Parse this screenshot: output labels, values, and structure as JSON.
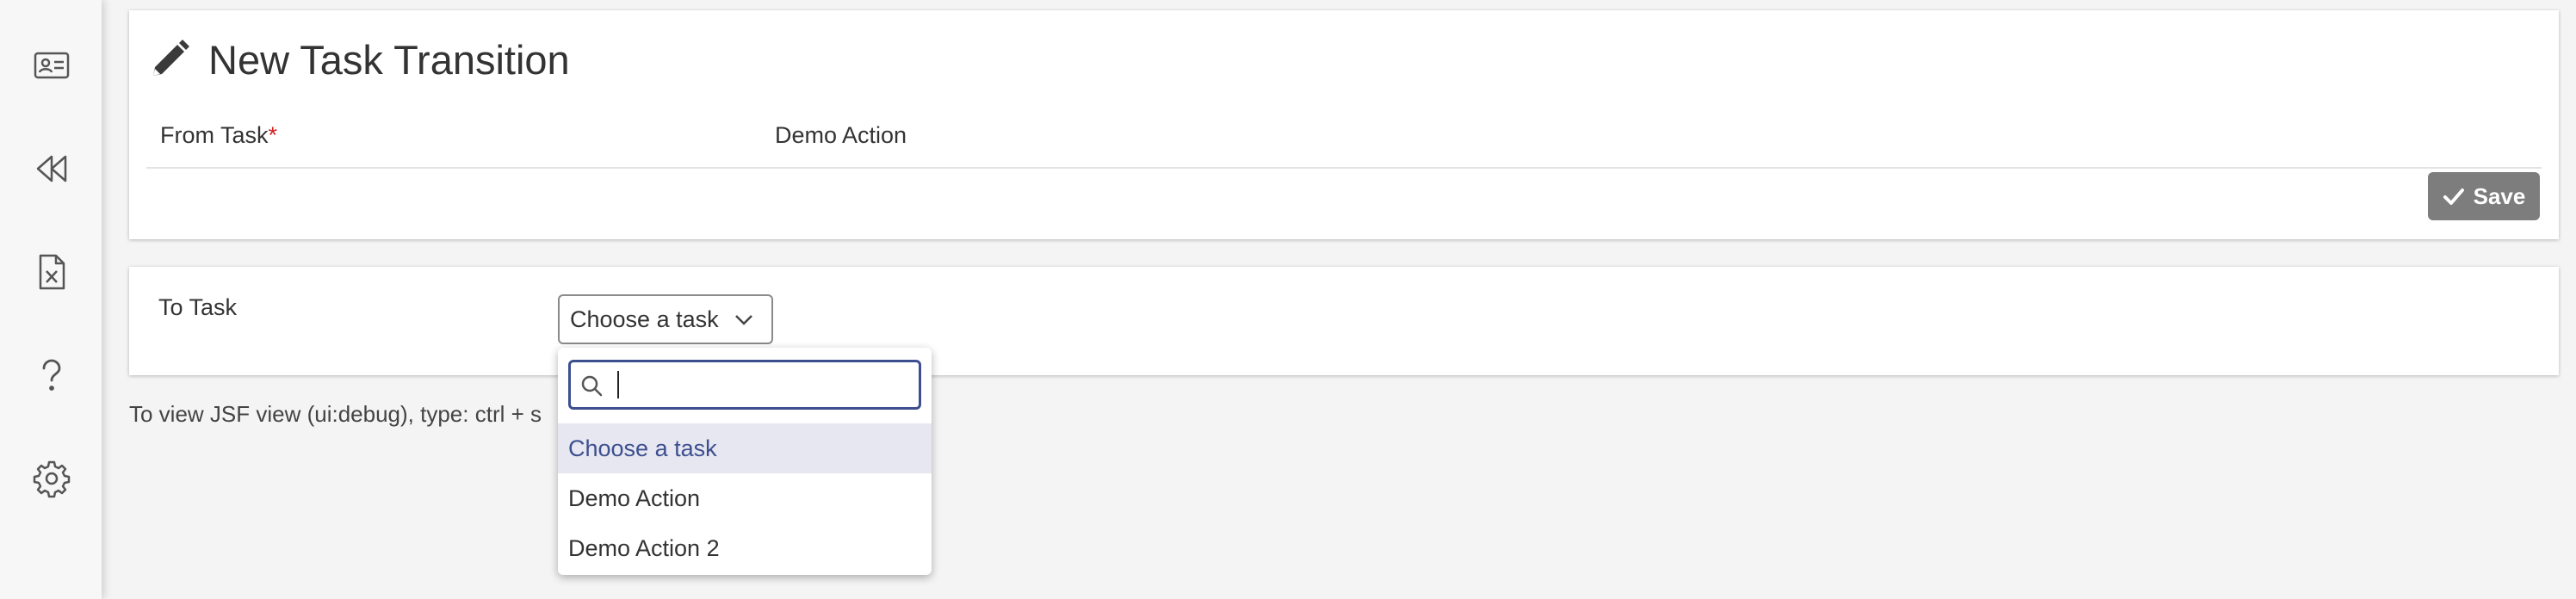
{
  "sidebar": {
    "items": [
      {
        "icon": "contact-card-icon"
      },
      {
        "icon": "rewind-icon"
      },
      {
        "icon": "excel-file-icon"
      },
      {
        "icon": "help-icon"
      },
      {
        "icon": "gear-icon"
      }
    ]
  },
  "header": {
    "title": "New Task Transition"
  },
  "form": {
    "from_task_label": "From Task",
    "required_mark": "*",
    "from_task_value": "Demo Action",
    "save_label": "Save",
    "to_task_label": "To Task",
    "to_task_selected": "Choose a task"
  },
  "dropdown": {
    "search_value": "",
    "options": [
      {
        "label": "Choose a task",
        "selected": true
      },
      {
        "label": "Demo Action",
        "selected": false
      },
      {
        "label": "Demo Action 2",
        "selected": false
      }
    ]
  },
  "footer": {
    "debug_text": "To view JSF view (ui:debug), type: ctrl + s"
  },
  "colors": {
    "accent": "#3d4f8f",
    "save_button": "#7d7d7d",
    "required": "#d62020",
    "selected_option_bg": "#e6e7f1"
  }
}
